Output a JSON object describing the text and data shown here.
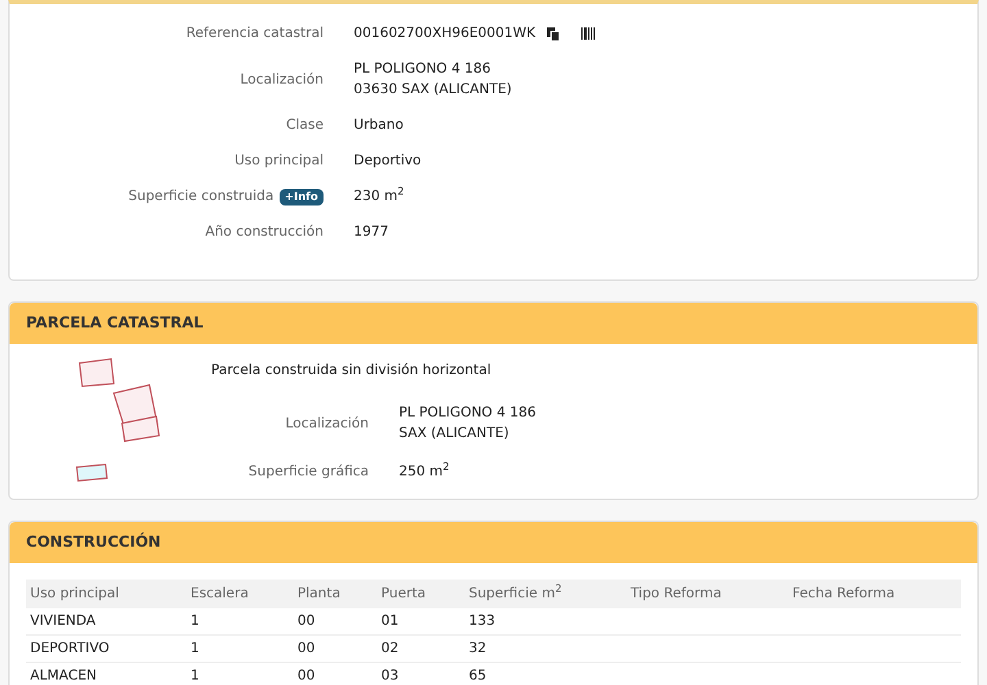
{
  "inmueble": {
    "fields": [
      {
        "kind": "ref",
        "label": "Referencia catastral",
        "lines": [
          "001602700XH96E0001WK"
        ]
      },
      {
        "kind": "text",
        "label": "Localización",
        "lines": [
          "PL POLIGONO 4 186",
          "03630 SAX (ALICANTE)"
        ]
      },
      {
        "kind": "text",
        "label": "Clase",
        "lines": [
          "Urbano"
        ]
      },
      {
        "kind": "text",
        "label": "Uso principal",
        "lines": [
          "Deportivo"
        ]
      },
      {
        "kind": "info",
        "label": "Superficie construida",
        "badge": "+Info",
        "lines": [
          "230 m$^{2}$"
        ]
      },
      {
        "kind": "text",
        "label": "Año construcción",
        "lines": [
          "1977"
        ]
      }
    ]
  },
  "parcela": {
    "title": "PARCELA CATASTRAL",
    "description": "Parcela construida sin división horizontal",
    "fields": [
      {
        "label": "Localización",
        "lines": [
          "PL POLIGONO 4 186",
          "SAX (ALICANTE)"
        ]
      },
      {
        "label": "Superficie gráfica",
        "lines": [
          "250 m$^{2}$"
        ]
      }
    ]
  },
  "construccion": {
    "title": "CONSTRUCCIÓN",
    "table": {
      "columns": [
        "Uso principal",
        "Escalera",
        "Planta",
        "Puerta",
        "Superficie m$^{2}$",
        "Tipo Reforma",
        "Fecha Reforma"
      ],
      "rows": [
        [
          "VIVIENDA",
          "1",
          "00",
          "01",
          "133"
        ],
        [
          "DEPORTIVO",
          "1",
          "00",
          "02",
          "32"
        ],
        [
          "ALMACEN",
          "1",
          "00",
          "03",
          "65"
        ]
      ]
    }
  }
}
